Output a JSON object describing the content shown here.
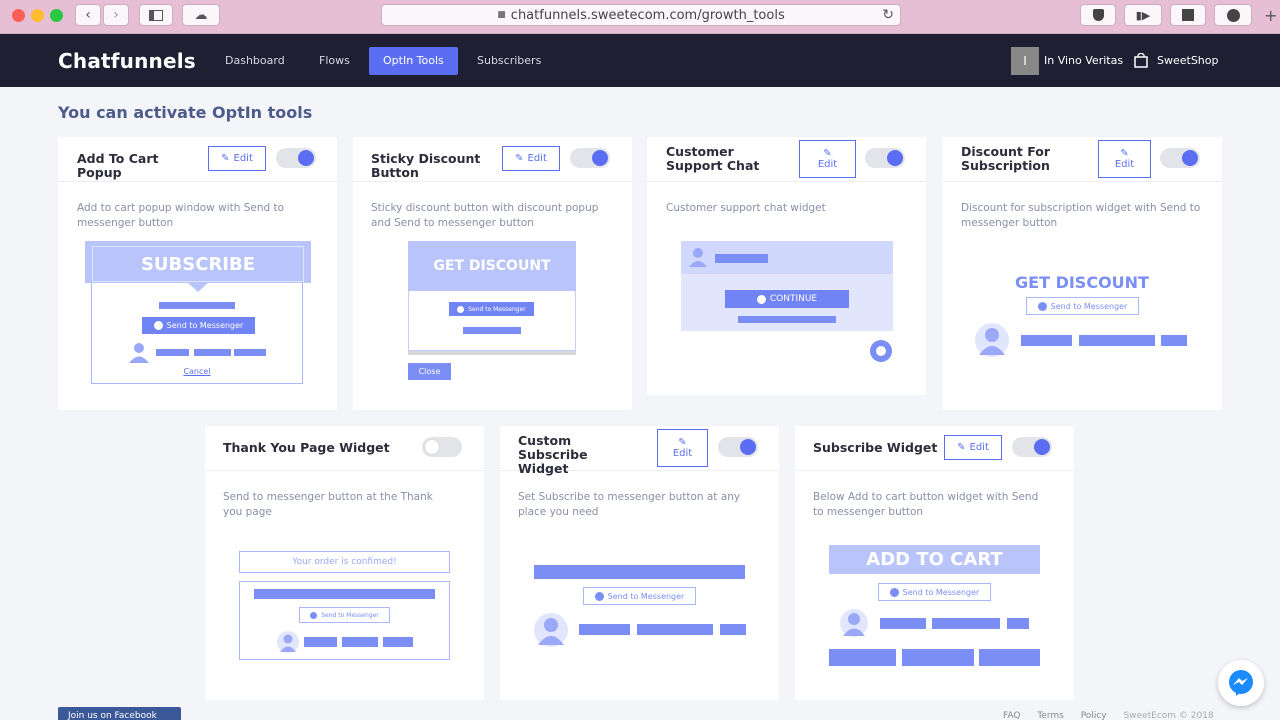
{
  "browser": {
    "url": "chatfunnels.sweetecom.com/growth_tools"
  },
  "nav": {
    "brand": "Chatfunnels",
    "links": [
      "Dashboard",
      "Flows",
      "OptIn Tools",
      "Subscribers"
    ],
    "active_index": 2,
    "store_initial": "I",
    "store_name": "In Vino Veritas",
    "shop_name": "SweetShop"
  },
  "page_title": "You can activate OptIn tools",
  "edit_label": "Edit",
  "cards": [
    {
      "title": "Add To Cart Popup",
      "desc": "Add to cart popup window with Send to messenger button",
      "enabled": true
    },
    {
      "title": "Sticky Discount Button",
      "desc": "Sticky discount button with discount popup and Send to messenger button",
      "enabled": true
    },
    {
      "title": "Customer Support Chat",
      "desc": "Customer support chat widget",
      "enabled": true
    },
    {
      "title": "Discount For Subscription",
      "desc": "Discount for subscription widget with Send to messenger button",
      "enabled": true
    },
    {
      "title": "Thank You Page Widget",
      "desc": "Send to messenger button at the Thank you page",
      "enabled": false
    },
    {
      "title": "Custom Subscribe Widget",
      "desc": "Set Subscribe to messenger button at any place you need",
      "enabled": true
    },
    {
      "title": "Subscribe Widget",
      "desc": "Below Add to cart button widget with Send to messenger button",
      "enabled": true
    }
  ],
  "previews": {
    "subscribe": "SUBSCRIBE",
    "send_to_messenger": "Send to Messenger",
    "cancel": "Cancel",
    "get_discount": "GET DISCOUNT",
    "close": "Close",
    "continue": "CONTINUE",
    "order_confirmed": "Your order is confimed!",
    "add_to_cart": "ADD TO CART"
  },
  "footer": {
    "facebook": "Join us on Facebook",
    "links": [
      "FAQ",
      "Terms",
      "Policy",
      "SweetEcom © 2018"
    ]
  },
  "colors": {
    "accent": "#5b6ef3",
    "nav_bg": "#1f1f33",
    "preview": "#7b8ef5"
  }
}
